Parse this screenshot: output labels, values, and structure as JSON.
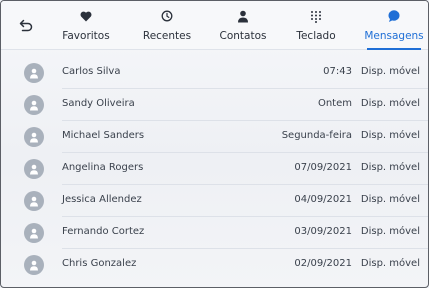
{
  "tabs": [
    {
      "label": "Favoritos",
      "icon": "heart-icon"
    },
    {
      "label": "Recentes",
      "icon": "clock-icon"
    },
    {
      "label": "Contatos",
      "icon": "person-icon"
    },
    {
      "label": "Teclado",
      "icon": "keypad-icon"
    },
    {
      "label": "Mensagens",
      "icon": "chat-bubble-icon",
      "active": true
    }
  ],
  "back_icon": "back-arrow-icon",
  "colors": {
    "accent": "#1f6fd6",
    "avatar": "#a9b1bc",
    "text": "#3a414c"
  },
  "messages": [
    {
      "name": "Carlos Silva",
      "time": "07:43",
      "device": "Disp. móvel"
    },
    {
      "name": "Sandy Oliveira",
      "time": "Ontem",
      "device": "Disp. móvel"
    },
    {
      "name": "Michael Sanders",
      "time": "Segunda-feira",
      "device": "Disp. móvel"
    },
    {
      "name": "Angelina Rogers",
      "time": "07/09/2021",
      "device": "Disp. móvel"
    },
    {
      "name": "Jessica Allendez",
      "time": "04/09/2021",
      "device": "Disp. móvel"
    },
    {
      "name": "Fernando Cortez",
      "time": "03/09/2021",
      "device": "Disp. móvel"
    },
    {
      "name": "Chris Gonzalez",
      "time": "02/09/2021",
      "device": "Disp. móvel"
    }
  ]
}
